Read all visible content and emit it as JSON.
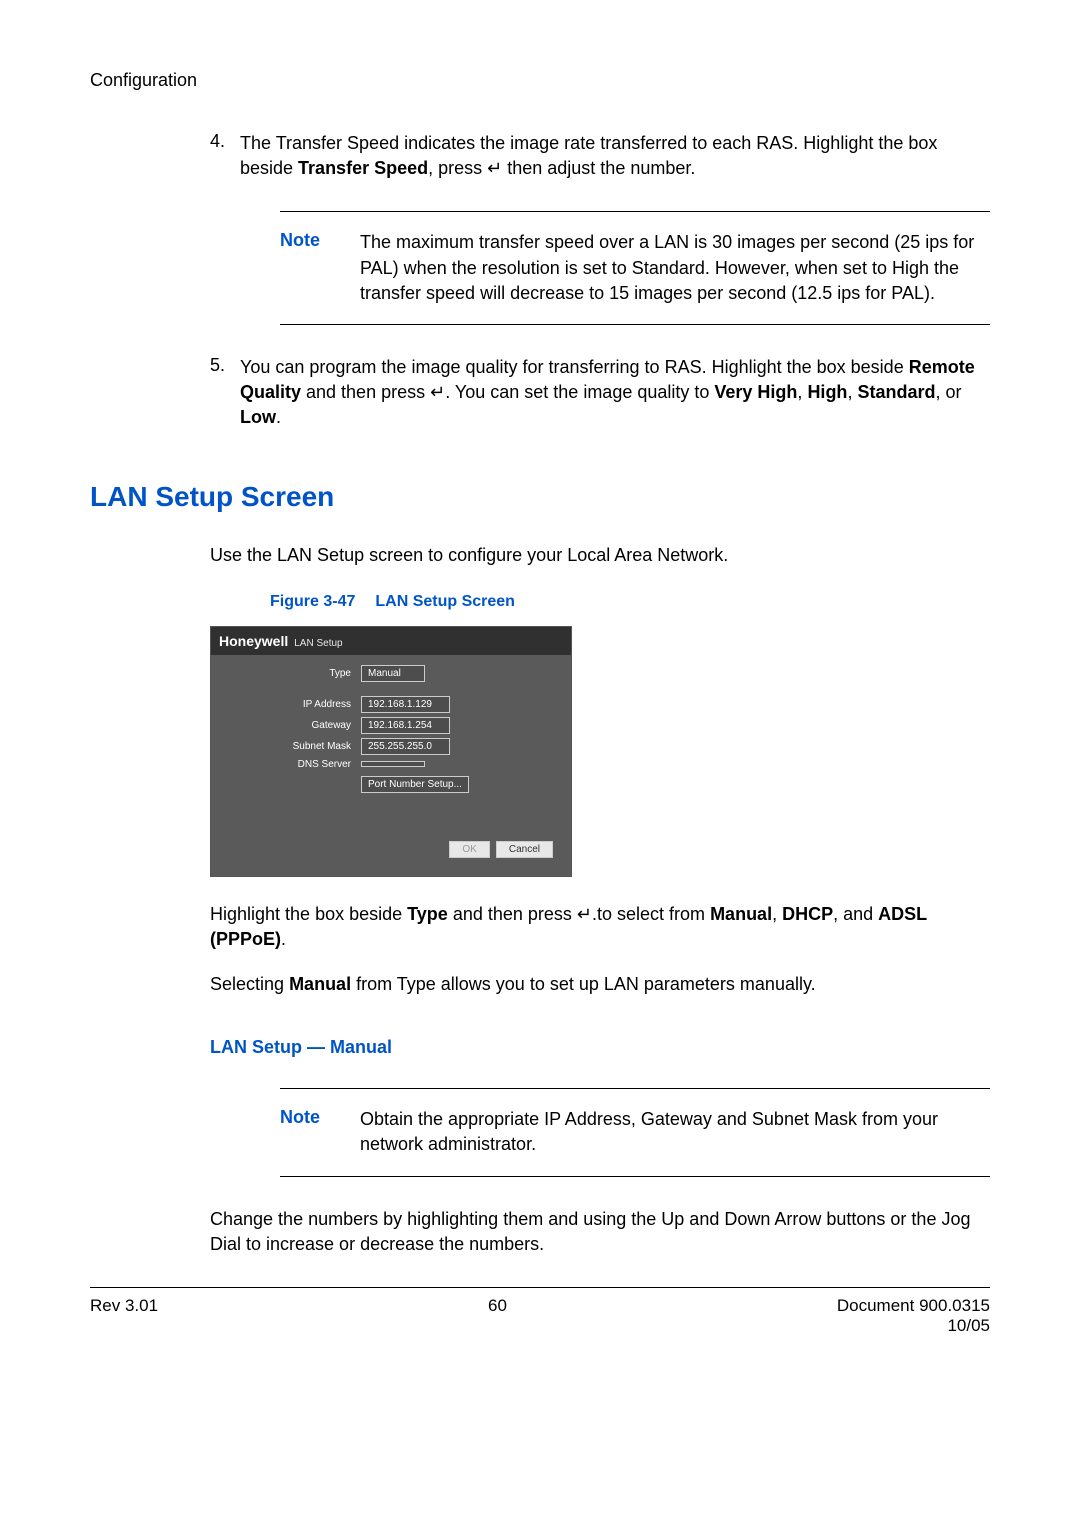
{
  "header": {
    "section": "Configuration"
  },
  "step4": {
    "num": "4.",
    "text_a": "The Transfer Speed indicates the image rate transferred to each RAS. Highlight the box beside ",
    "bold_a": "Transfer Speed",
    "text_b": ", press ",
    "enter": "↵",
    "text_c": " then adjust the number."
  },
  "note1": {
    "label": "Note",
    "text": "The maximum transfer speed over a LAN is 30 images per second (25 ips for PAL) when the resolution is set to Standard. However, when set to High the transfer speed will decrease to 15 images per second (12.5 ips for PAL)."
  },
  "step5": {
    "num": "5.",
    "text_a": "You can program the image quality for transferring to RAS. Highlight the box beside ",
    "bold_a": "Remote Quality",
    "text_b": " and then press ",
    "enter": "↵",
    "text_c": ". You can set the image quality to ",
    "bold_b": "Very High",
    "sep1": ", ",
    "bold_c": "High",
    "sep2": ", ",
    "bold_d": "Standard",
    "sep3": ", or ",
    "bold_e": "Low",
    "end": "."
  },
  "h1": "LAN Setup Screen",
  "intro": "Use the LAN Setup screen to configure your Local Area Network.",
  "figcap": {
    "num": "Figure 3-47",
    "title": "LAN Setup Screen"
  },
  "lan": {
    "brand": "Honeywell",
    "title": "LAN Setup",
    "rows": {
      "type_label": "Type",
      "type_val": "Manual",
      "ip_label": "IP Address",
      "ip_val": "192.168.1.129",
      "gw_label": "Gateway",
      "gw_val": "192.168.1.254",
      "sn_label": "Subnet Mask",
      "sn_val": "255.255.255.0",
      "dns_label": "DNS Server",
      "dns_val": ""
    },
    "port_btn": "Port Number Setup...",
    "ok": "OK",
    "cancel": "Cancel"
  },
  "p_type": {
    "a": "Highlight the box beside ",
    "b_type": "Type",
    "c": " and then press ",
    "enter": "↵",
    "d": ".to select from ",
    "b_manual": "Manual",
    "sep1": ", ",
    "b_dhcp": "DHCP",
    "sep2": ", and ",
    "b_adsl": "ADSL (PPPoE)",
    "end": "."
  },
  "p_manual": {
    "a": "Selecting ",
    "b": "Manual",
    "c": " from Type allows you to set up LAN parameters manually."
  },
  "sub": "LAN Setup — Manual",
  "note2": {
    "label": "Note",
    "text": "Obtain the appropriate IP Address, Gateway and Subnet Mask from your network administrator."
  },
  "p_change": "Change the numbers by highlighting them and using the Up and Down Arrow buttons or the Jog Dial to increase or decrease the numbers.",
  "footer": {
    "rev": "Rev 3.01",
    "page": "60",
    "doc": "Document 900.0315",
    "date": "10/05"
  }
}
